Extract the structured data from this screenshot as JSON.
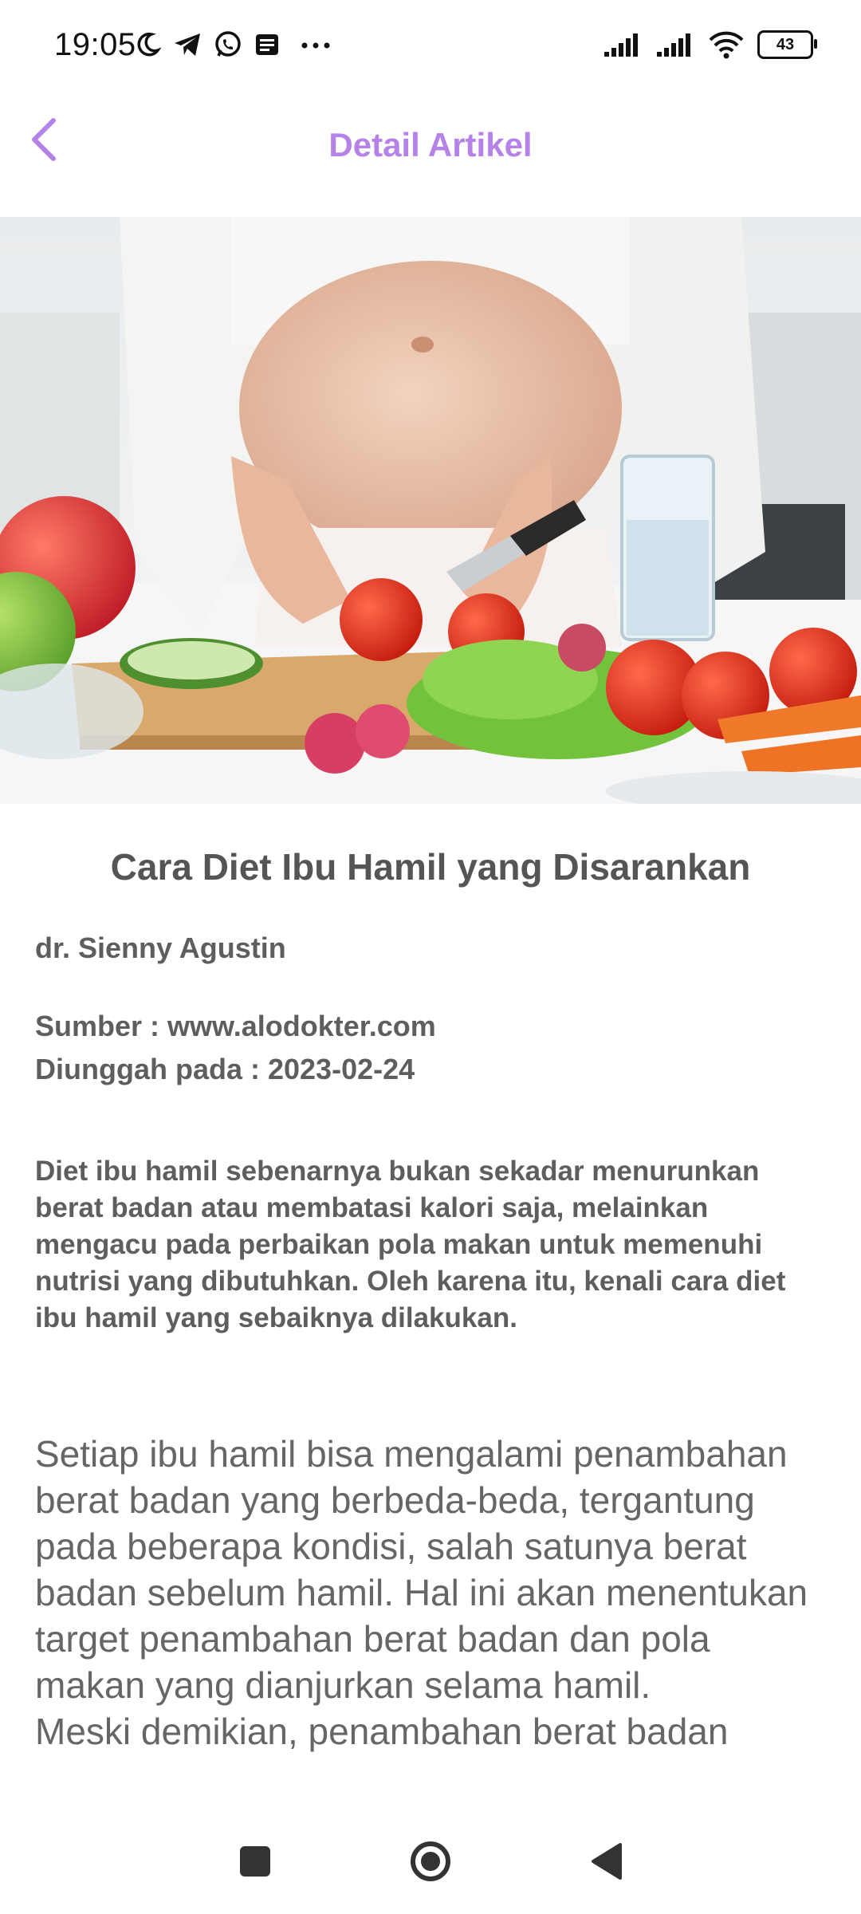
{
  "status_bar": {
    "time": "19:05",
    "battery_level": "43",
    "left_icons": [
      "moon-icon",
      "telegram-icon",
      "whatsapp-icon",
      "notes-icon",
      "more-dots-icon"
    ],
    "right_icons": [
      "signal-icon",
      "signal-icon",
      "wifi-icon",
      "battery-icon"
    ]
  },
  "header": {
    "title": "Detail Artikel",
    "accent_color": "#b583e8"
  },
  "hero_image": {
    "subject": "pregnant woman slicing tomato with vegetables"
  },
  "article": {
    "title": "Cara Diet Ibu Hamil yang Disarankan",
    "author": "dr. Sienny Agustin",
    "source": "Sumber : www.alodokter.com",
    "uploaded": "Diunggah pada : 2023-02-24",
    "summary": "Diet ibu hamil sebenarnya bukan sekadar menurunkan berat badan atau membatasi kalori saja, melainkan mengacu pada perbaikan pola makan untuk memenuhi nutrisi yang dibutuhkan. Oleh karena itu, kenali cara diet ibu hamil yang sebaiknya dilakukan.",
    "body_paragraph_1": "Setiap ibu hamil bisa mengalami penambahan berat badan yang berbeda-beda, tergantung pada beberapa kondisi, salah satunya berat badan sebelum hamil. Hal ini akan menentukan target penambahan berat badan dan pola makan yang dianjurkan selama hamil.",
    "body_paragraph_2": "Meski demikian, penambahan berat badan"
  },
  "nav_bar": {
    "buttons": [
      "recents-icon",
      "home-icon",
      "back-icon"
    ]
  }
}
